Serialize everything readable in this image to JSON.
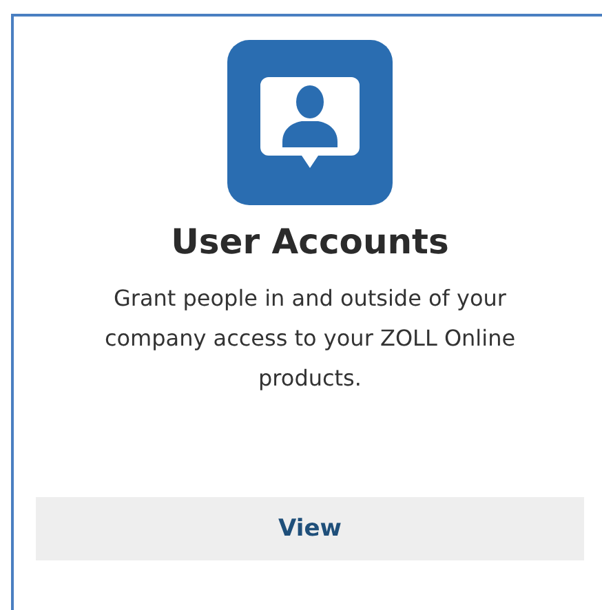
{
  "card": {
    "title": "User Accounts",
    "description": "Grant people in and outside of your company access to your ZOLL Online products.",
    "button": "View"
  }
}
